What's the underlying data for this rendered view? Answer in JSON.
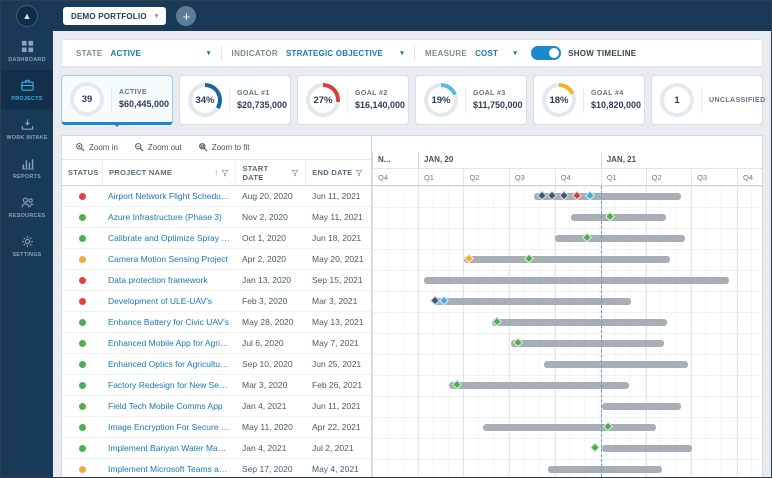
{
  "topbar": {
    "portfolio_label": "DEMO PORTFOLIO",
    "add_button": "+"
  },
  "sidebar": {
    "items": [
      {
        "id": "dashboard",
        "label": "DASHBOARD",
        "icon": "dashboard",
        "active": false
      },
      {
        "id": "projects",
        "label": "PROJECTS",
        "icon": "projects",
        "active": true
      },
      {
        "id": "work-intake",
        "label": "WORK INTAKE",
        "icon": "work-intake",
        "active": false
      },
      {
        "id": "reports",
        "label": "REPORTS",
        "icon": "reports",
        "active": false
      },
      {
        "id": "resources",
        "label": "RESOURCES",
        "icon": "resources",
        "active": false
      },
      {
        "id": "settings",
        "label": "SETTINGS",
        "icon": "settings",
        "active": false
      }
    ]
  },
  "filters": {
    "state_label": "STATE",
    "state_value": "ACTIVE",
    "indicator_label": "INDICATOR",
    "indicator_value": "STRATEGIC OBJECTIVE",
    "measure_label": "MEASURE",
    "measure_value": "COST",
    "show_timeline_label": "SHOW TIMELINE",
    "show_timeline_on": true
  },
  "kpi_cards": [
    {
      "id": "active",
      "type": "count",
      "value": "39",
      "label": "ACTIVE",
      "amount": "$60,445,000",
      "selected": true
    },
    {
      "id": "goal-1",
      "type": "donut",
      "value": "34%",
      "percent": 34,
      "color": "#1565a7",
      "label": "GOAL #1",
      "amount": "$20,735,000",
      "selected": false
    },
    {
      "id": "goal-2",
      "type": "donut",
      "value": "27%",
      "percent": 27,
      "color": "#d6403a",
      "label": "GOAL #2",
      "amount": "$16,140,000",
      "selected": false
    },
    {
      "id": "goal-3",
      "type": "donut",
      "value": "19%",
      "percent": 19,
      "color": "#56b9e8",
      "label": "GOAL #3",
      "amount": "$11,750,000",
      "selected": false
    },
    {
      "id": "goal-4",
      "type": "donut",
      "value": "18%",
      "percent": 18,
      "color": "#f0b429",
      "label": "GOAL #4",
      "amount": "$10,820,000",
      "selected": false
    },
    {
      "id": "unclassified",
      "type": "count",
      "value": "1",
      "label": "UNCLASSIFIED",
      "amount": "",
      "selected": false
    }
  ],
  "gantt_toolbar": {
    "zoom_in": "Zoom in",
    "zoom_out": "Zoom out",
    "zoom_fit": "Zoom to fit"
  },
  "table_headers": {
    "status": "STATUS",
    "name": "PROJECT NAME",
    "start": "START DATE",
    "end": "END DATE"
  },
  "status_colors": {
    "red": "#e0433c",
    "green": "#4cae4f",
    "yellow": "#f2a93b"
  },
  "marker_colors": {
    "navy": "#3b566e",
    "green": "#4cae4f",
    "ltblue": "#41a8e0",
    "red": "#d6403a",
    "yellow": "#f0ad2d"
  },
  "gantt": {
    "timeline": {
      "start": "2019-10-01",
      "end": "2021-11-20",
      "today": "2021-01-01"
    },
    "months": [
      {
        "label": "N...",
        "from": "2019-10-01"
      },
      {
        "label": "JAN, 20",
        "from": "2020-01-01"
      },
      {
        "label": "JAN, 21",
        "from": "2021-01-01"
      }
    ],
    "quarters": [
      {
        "label": "Q4",
        "from": "2019-10-01"
      },
      {
        "label": "Q1",
        "from": "2020-01-01"
      },
      {
        "label": "Q2",
        "from": "2020-04-01"
      },
      {
        "label": "Q3",
        "from": "2020-07-01"
      },
      {
        "label": "Q4",
        "from": "2020-10-01"
      },
      {
        "label": "Q1",
        "from": "2021-01-01"
      },
      {
        "label": "Q2",
        "from": "2021-04-01"
      },
      {
        "label": "Q3",
        "from": "2021-07-01"
      },
      {
        "label": "Q4",
        "from": "2021-10-01"
      }
    ]
  },
  "projects": [
    {
      "status": "red",
      "name": "Airport Network Flight Scheduler",
      "start_display": "Aug 20, 2020",
      "end_display": "Jun 11, 2021",
      "start": "2020-08-20",
      "end": "2021-06-11",
      "markers": [
        {
          "date": "2020-09-05",
          "color": "navy"
        },
        {
          "date": "2020-09-25",
          "color": "navy"
        },
        {
          "date": "2020-10-20",
          "color": "navy"
        },
        {
          "date": "2020-11-15",
          "color": "red"
        },
        {
          "date": "2020-12-10",
          "color": "ltblue"
        }
      ]
    },
    {
      "status": "green",
      "name": "Azure Infrastructure (Phase 3)",
      "start_display": "Nov 2, 2020",
      "end_display": "May 11, 2021",
      "start": "2020-11-02",
      "end": "2021-05-11",
      "markers": [
        {
          "date": "2021-01-20",
          "color": "green"
        }
      ]
    },
    {
      "status": "green",
      "name": "Calibrate and Optimize Spray Technol...",
      "start_display": "Oct 1, 2020",
      "end_display": "Jun 18, 2021",
      "start": "2020-10-01",
      "end": "2021-06-18",
      "markers": [
        {
          "date": "2020-12-05",
          "color": "green"
        }
      ]
    },
    {
      "status": "yellow",
      "name": "Camera Motion Sensing Project",
      "start_display": "Apr 2, 2020",
      "end_display": "May 20, 2021",
      "start": "2020-04-02",
      "end": "2021-05-20",
      "markers": [
        {
          "date": "2020-04-12",
          "color": "yellow"
        },
        {
          "date": "2020-08-10",
          "color": "green"
        }
      ]
    },
    {
      "status": "red",
      "name": "Data protection framework",
      "start_display": "Jan 13, 2020",
      "end_display": "Sep 15, 2021",
      "start": "2020-01-13",
      "end": "2021-09-15",
      "markers": []
    },
    {
      "status": "red",
      "name": "Development of ULE-UAV's",
      "start_display": "Feb 3, 2020",
      "end_display": "Mar 3, 2021",
      "start": "2020-02-03",
      "end": "2021-03-03",
      "markers": [
        {
          "date": "2020-02-05",
          "color": "navy"
        },
        {
          "date": "2020-02-22",
          "color": "ltblue"
        }
      ]
    },
    {
      "status": "green",
      "name": "Enhance Battery for Civic UAV's",
      "start_display": "May 28, 2020",
      "end_display": "May 13, 2021",
      "start": "2020-05-28",
      "end": "2021-05-13",
      "markers": [
        {
          "date": "2020-06-08",
          "color": "green"
        }
      ]
    },
    {
      "status": "green",
      "name": "Enhanced Mobile App for Agricultural...",
      "start_display": "Jul 6, 2020",
      "end_display": "May 7, 2021",
      "start": "2020-07-06",
      "end": "2021-05-07",
      "markers": [
        {
          "date": "2020-07-20",
          "color": "green"
        }
      ]
    },
    {
      "status": "green",
      "name": "Enhanced Optics for Agricultural UAV's",
      "start_display": "Sep 10, 2020",
      "end_display": "Jun 25, 2021",
      "start": "2020-09-10",
      "end": "2021-06-25",
      "markers": []
    },
    {
      "status": "green",
      "name": "Factory Redesign for New Service Bu...",
      "start_display": "Mar 3, 2020",
      "end_display": "Feb 26, 2021",
      "start": "2020-03-03",
      "end": "2021-02-26",
      "markers": [
        {
          "date": "2020-03-20",
          "color": "green"
        }
      ]
    },
    {
      "status": "green",
      "name": "Field Tech Mobile Comms App",
      "start_display": "Jan 4, 2021",
      "end_display": "Jun 11, 2021",
      "start": "2021-01-04",
      "end": "2021-06-11",
      "markers": []
    },
    {
      "status": "green",
      "name": "Image Encryption For Secure Transfer",
      "start_display": "May 11, 2020",
      "end_display": "Apr 22, 2021",
      "start": "2020-05-11",
      "end": "2021-04-22",
      "markers": [
        {
          "date": "2021-01-15",
          "color": "green"
        }
      ]
    },
    {
      "status": "green",
      "name": "Implement Banyan Water Manageme...",
      "start_display": "Jan 4, 2021",
      "end_display": "Jul 2, 2021",
      "start": "2021-01-04",
      "end": "2021-07-02",
      "markers": [
        {
          "date": "2020-12-20",
          "color": "green"
        }
      ]
    },
    {
      "status": "yellow",
      "name": "Implement Microsoft Teams and Retir...",
      "start_display": "Sep 17, 2020",
      "end_display": "May 4, 2021",
      "start": "2020-09-17",
      "end": "2021-05-04",
      "markers": []
    }
  ]
}
